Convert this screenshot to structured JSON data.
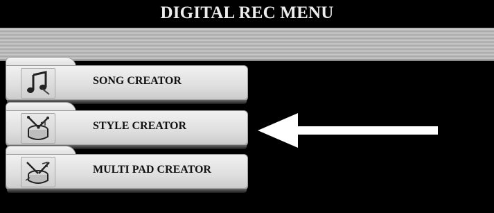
{
  "header": {
    "title": "DIGITAL REC MENU"
  },
  "menu": {
    "items": [
      {
        "label": "SONG CREATOR",
        "icon": "music-note-icon"
      },
      {
        "label": "STYLE CREATOR",
        "icon": "drum-icon"
      },
      {
        "label": "MULTI PAD CREATOR",
        "icon": "drum-pad-icon"
      }
    ]
  },
  "indicator": {
    "icon": "left-arrow-icon",
    "color": "#ffffff"
  }
}
